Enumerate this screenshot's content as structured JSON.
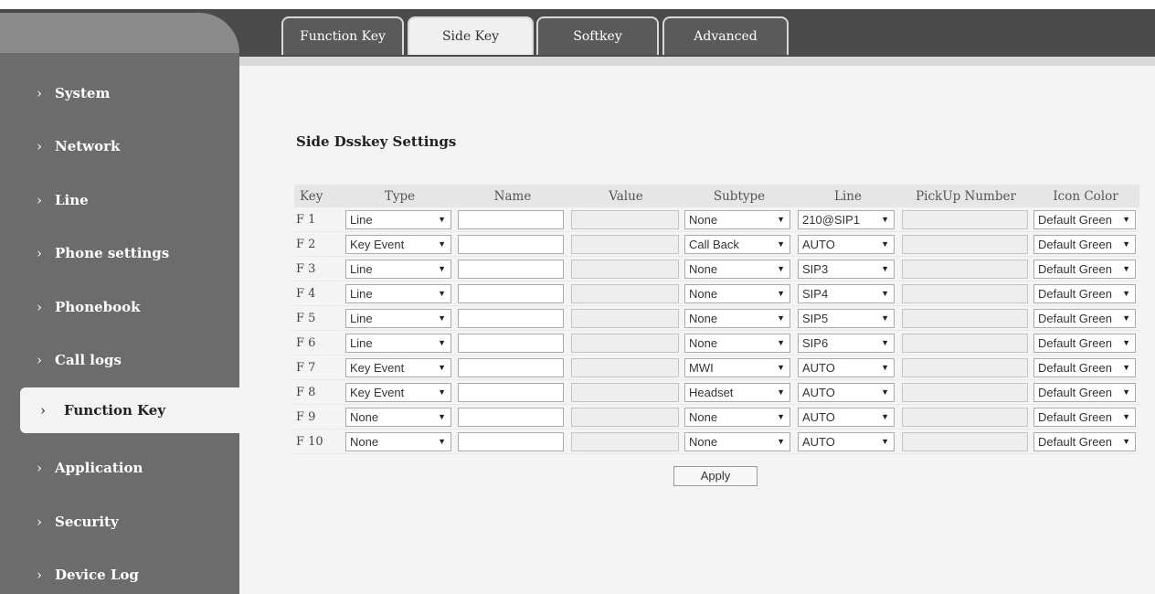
{
  "sidebar": {
    "items": [
      {
        "label": "System"
      },
      {
        "label": "Network"
      },
      {
        "label": "Line"
      },
      {
        "label": "Phone settings"
      },
      {
        "label": "Phonebook"
      },
      {
        "label": "Call logs"
      },
      {
        "label": "Function Key",
        "active": true
      },
      {
        "label": "Application"
      },
      {
        "label": "Security"
      },
      {
        "label": "Device Log"
      }
    ]
  },
  "tabs": [
    {
      "label": "Function Key",
      "active": false
    },
    {
      "label": "Side Key",
      "active": true
    },
    {
      "label": "Softkey",
      "active": false
    },
    {
      "label": "Advanced",
      "active": false
    }
  ],
  "section_title": "Side Dsskey Settings",
  "table": {
    "columns": [
      "Key",
      "Type",
      "Name",
      "Value",
      "Subtype",
      "Line",
      "PickUp Number",
      "Icon Color"
    ],
    "rows": [
      {
        "key": "F 1",
        "type": "Line",
        "name": "",
        "value": "",
        "subtype": "None",
        "line": "210@SIP1",
        "pickup": "",
        "icon_color": "Default Green"
      },
      {
        "key": "F 2",
        "type": "Key Event",
        "name": "",
        "value": "",
        "subtype": "Call Back",
        "line": "AUTO",
        "pickup": "",
        "icon_color": "Default Green"
      },
      {
        "key": "F 3",
        "type": "Line",
        "name": "",
        "value": "",
        "subtype": "None",
        "line": "SIP3",
        "pickup": "",
        "icon_color": "Default Green"
      },
      {
        "key": "F 4",
        "type": "Line",
        "name": "",
        "value": "",
        "subtype": "None",
        "line": "SIP4",
        "pickup": "",
        "icon_color": "Default Green"
      },
      {
        "key": "F 5",
        "type": "Line",
        "name": "",
        "value": "",
        "subtype": "None",
        "line": "SIP5",
        "pickup": "",
        "icon_color": "Default Green"
      },
      {
        "key": "F 6",
        "type": "Line",
        "name": "",
        "value": "",
        "subtype": "None",
        "line": "SIP6",
        "pickup": "",
        "icon_color": "Default Green"
      },
      {
        "key": "F 7",
        "type": "Key Event",
        "name": "",
        "value": "",
        "subtype": "MWI",
        "line": "AUTO",
        "pickup": "",
        "icon_color": "Default Green"
      },
      {
        "key": "F 8",
        "type": "Key Event",
        "name": "",
        "value": "",
        "subtype": "Headset",
        "line": "AUTO",
        "pickup": "",
        "icon_color": "Default Green"
      },
      {
        "key": "F 9",
        "type": "None",
        "name": "",
        "value": "",
        "subtype": "None",
        "line": "AUTO",
        "pickup": "",
        "icon_color": "Default Green"
      },
      {
        "key": "F 10",
        "type": "None",
        "name": "",
        "value": "",
        "subtype": "None",
        "line": "AUTO",
        "pickup": "",
        "icon_color": "Default Green"
      }
    ]
  },
  "apply_label": "Apply",
  "icons": {
    "nav_chevron": "chevron-right-icon",
    "select_arrow": "dropdown-arrow-icon"
  },
  "colors": {
    "sidebar": "#6c6c6c",
    "tab_bar": "#4a4a4a",
    "active_tab": "#f0f0f0",
    "content": "#f4f4f4"
  }
}
